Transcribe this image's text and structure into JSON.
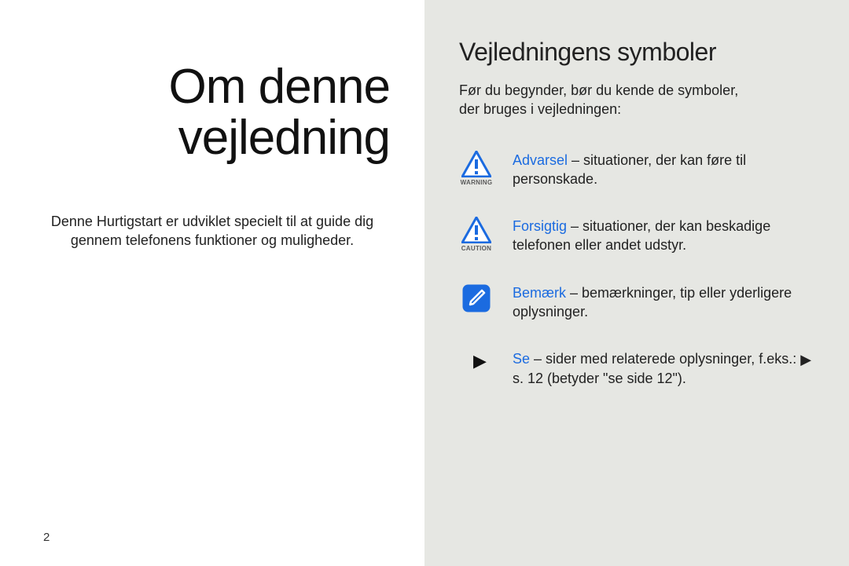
{
  "left": {
    "title_line1": "Om denne",
    "title_line2": "vejledning",
    "intro_line1": "Denne Hurtigstart er udviklet specielt til at guide dig",
    "intro_line2": "gennem telefonens funktioner og muligheder.",
    "page_number": "2"
  },
  "right": {
    "heading": "Vejledningens symboler",
    "lead_line1": "Før du begynder, bør du kende de symboler,",
    "lead_line2": "der bruges i vejledningen:",
    "rows": [
      {
        "icon_caption": "WARNING",
        "term": "Advarsel",
        "dash": " – ",
        "rest": "situationer, der kan føre til personskade."
      },
      {
        "icon_caption": "CAUTION",
        "term": "Forsigtig",
        "dash": " – ",
        "rest": "situationer, der kan beskadige telefonen eller andet udstyr."
      },
      {
        "icon_caption": "",
        "term": "Bemærk",
        "dash": " – ",
        "rest": "bemærkninger, tip eller yderligere oplysninger."
      },
      {
        "icon_caption": "",
        "term": "Se",
        "dash": " – ",
        "rest_a": "sider med relaterede oplysninger, f.eks.: ",
        "arrow": "▶",
        "rest_b": " s. 12 (betyder \"se side 12\")."
      }
    ]
  }
}
